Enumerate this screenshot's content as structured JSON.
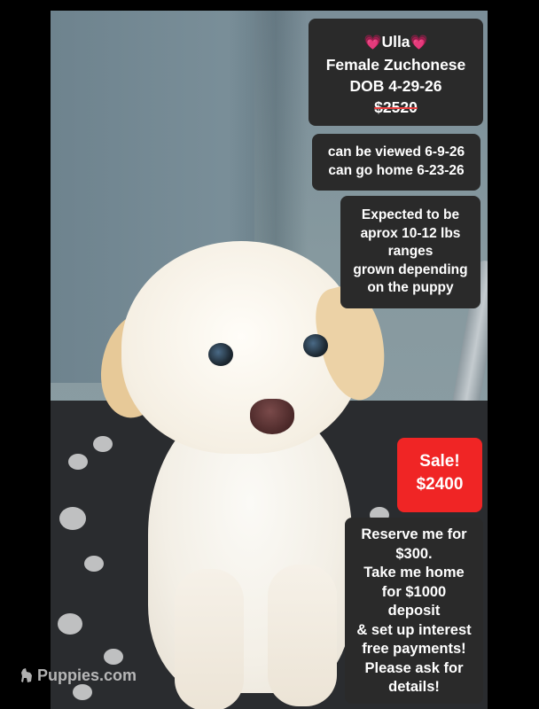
{
  "listing": {
    "name": "Ulla",
    "heart_glyph": "💗",
    "breed_line": "Female Zuchonese",
    "dob_line": "DOB 4-29-26",
    "original_price": "$2520"
  },
  "schedule": {
    "viewing_line": "can be viewed 6-9-26",
    "go_home_line": "can go home 6-23-26"
  },
  "size_info": {
    "lines": [
      "Expected to be",
      "aprox 10-12 lbs",
      "ranges",
      "grown depending",
      "on the puppy"
    ]
  },
  "sale": {
    "label": "Sale!",
    "price": "$2400",
    "color": "#f02525"
  },
  "reservation": {
    "lines": [
      "Reserve me for",
      "$300.",
      "Take me home",
      "for $1000",
      "deposit",
      "& set up interest",
      "free payments!",
      "Please ask for",
      "details!"
    ]
  },
  "watermark": {
    "text": "Puppies.com",
    "icon": "dog-logo-icon"
  }
}
